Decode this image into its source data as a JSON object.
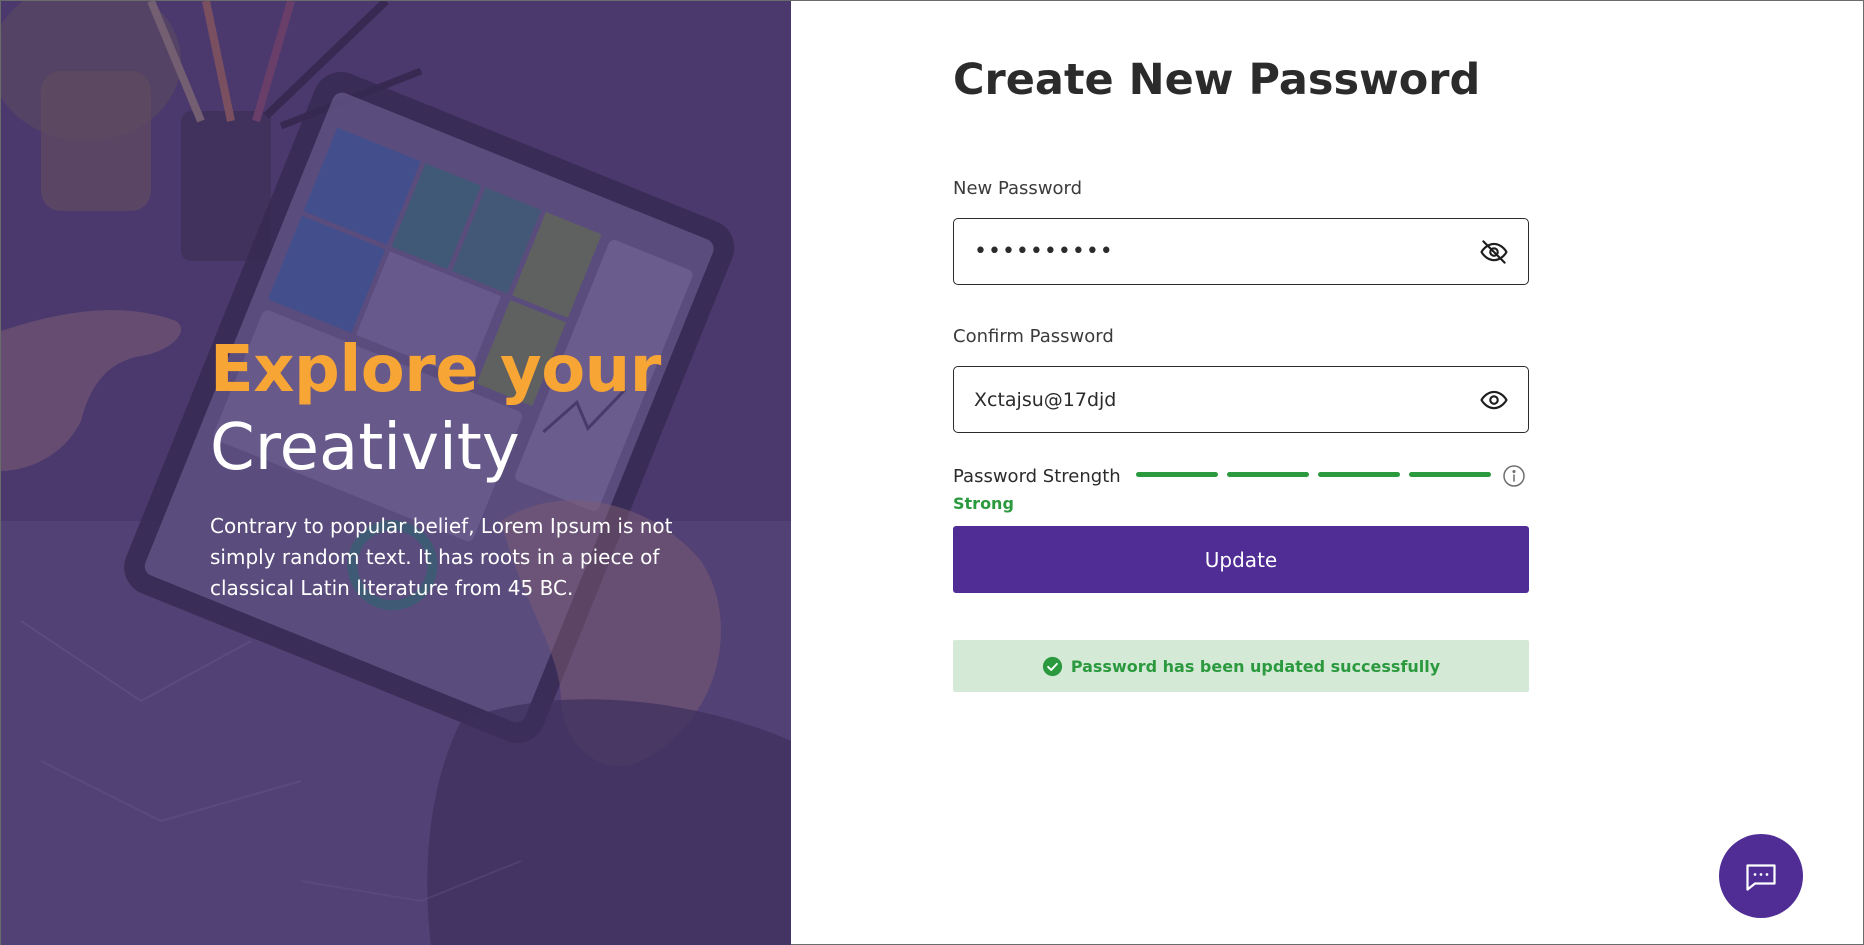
{
  "hero": {
    "title_line1": "Explore your",
    "title_line2": "Creativity",
    "description": "Contrary to popular belief, Lorem Ipsum is not simply random text. It has roots in a piece of classical Latin literature from 45 BC."
  },
  "form": {
    "title": "Create New Password",
    "new_password": {
      "label": "New Password",
      "value": "••••••••••",
      "toggle_icon": "eye-off-icon"
    },
    "confirm_password": {
      "label": "Confirm Password",
      "value": "Xctajsu@17djd",
      "toggle_icon": "eye-icon"
    },
    "strength": {
      "label": "Password Strength",
      "value": "Strong",
      "filled_segments": 4,
      "total_segments": 4,
      "color": "#2b9a3e",
      "info_icon": "info-icon"
    },
    "submit_label": "Update",
    "success_message": "Password has been updated successfully"
  },
  "chat": {
    "icon": "chat-icon"
  },
  "colors": {
    "accent": "#4f2d94",
    "hero_highlight": "#f7a534",
    "success": "#2b9a3e",
    "success_bg": "#d4ead7"
  }
}
